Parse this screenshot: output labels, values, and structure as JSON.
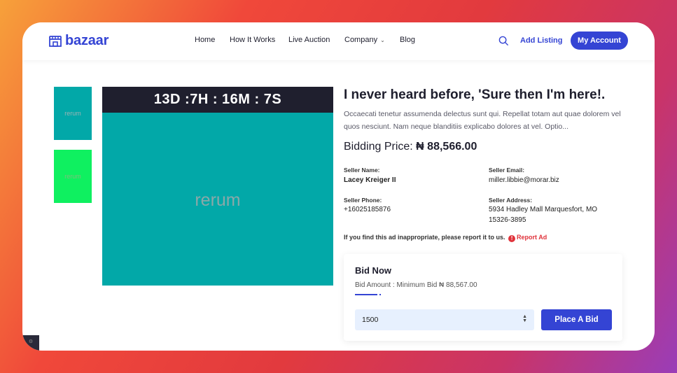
{
  "brand": {
    "name": "bazaar",
    "accent": "#3444d4"
  },
  "nav": {
    "home": "Home",
    "how_it_works": "How It Works",
    "live_auction": "Live Auction",
    "company": "Company",
    "blog": "Blog",
    "add_listing": "Add Listing",
    "my_account": "My Account"
  },
  "gallery": {
    "thumb1_label": "rerum",
    "thumb2_label": "rerum",
    "main_label": "rerum",
    "countdown": "13D :7H : 16M : 7S"
  },
  "product": {
    "title": "I never heard before, 'Sure then I'm here!.",
    "description": "Occaecati tenetur assumenda delectus sunt qui. Repellat totam aut quae dolorem vel quos nesciunt. Nam neque blanditiis explicabo dolores at vel. Optio...",
    "price_label": "Bidding Price:",
    "price_value": "₦ 88,566.00"
  },
  "seller": {
    "name_label": "Seller Name:",
    "name": "Lacey Kreiger II",
    "email_label": "Seller Email:",
    "email": "miller.libbie@morar.biz",
    "phone_label": "Seller Phone:",
    "phone": "+16025185876",
    "address_label": "Seller Address:",
    "address": "5934 Hadley Mall Marquesfort, MO 15326-3895"
  },
  "report": {
    "text": "If you find this ad inappropriate, please report it to us.",
    "link": "Report Ad"
  },
  "bid": {
    "title": "Bid Now",
    "subtitle": "Bid Amount : Minimum Bid ₦ 88,567.00",
    "input_value": "1500",
    "button": "Place A Bid"
  }
}
